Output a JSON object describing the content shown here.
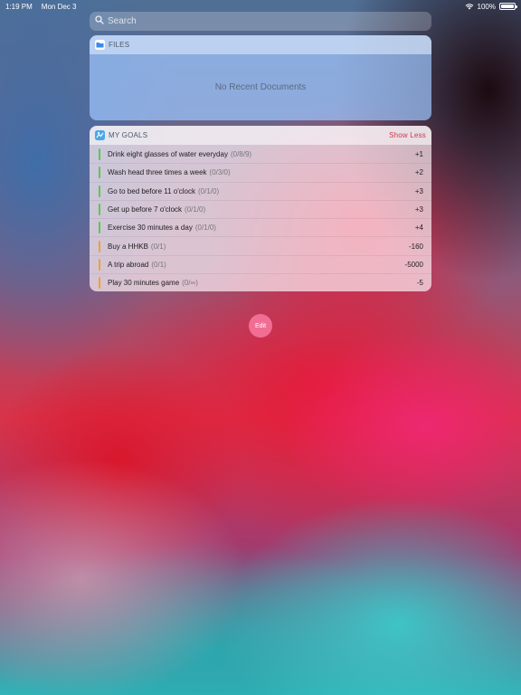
{
  "status_bar": {
    "time": "1:19 PM",
    "date": "Mon Dec 3",
    "battery_percent": "100%",
    "battery_level": 1.0
  },
  "search": {
    "placeholder": "Search"
  },
  "files_widget": {
    "title": "FILES",
    "empty_text": "No Recent Documents",
    "icon": "folder-icon",
    "accent": "#3a8be8"
  },
  "goals_widget": {
    "title": "MY GOALS",
    "show_less_label": "Show Less",
    "icon": "goals-app-icon",
    "items": [
      {
        "title": "Drink eight glasses of water everyday",
        "progress": "(0/8/9)",
        "score": "+1",
        "status_color": "#5cc84a"
      },
      {
        "title": "Wash head three times a week",
        "progress": "(0/3/0)",
        "score": "+2",
        "status_color": "#5cc84a"
      },
      {
        "title": "Go to bed before 11 o'clock",
        "progress": "(0/1/0)",
        "score": "+3",
        "status_color": "#5cc84a"
      },
      {
        "title": "Get up before 7 o'clock",
        "progress": "(0/1/0)",
        "score": "+3",
        "status_color": "#5cc84a"
      },
      {
        "title": "Exercise 30 minutes a day",
        "progress": "(0/1/0)",
        "score": "+4",
        "status_color": "#5cc84a"
      },
      {
        "title": "Buy a HHKB",
        "progress": "(0/1)",
        "score": "-160",
        "status_color": "#f0a030"
      },
      {
        "title": "A trip abroad",
        "progress": "(0/1)",
        "score": "-5000",
        "status_color": "#f0a030"
      },
      {
        "title": "Play 30 minutes game",
        "progress": "(0/∞)",
        "score": "-5",
        "status_color": "#f0a030"
      }
    ]
  },
  "edit_button": {
    "label": "Edit"
  }
}
